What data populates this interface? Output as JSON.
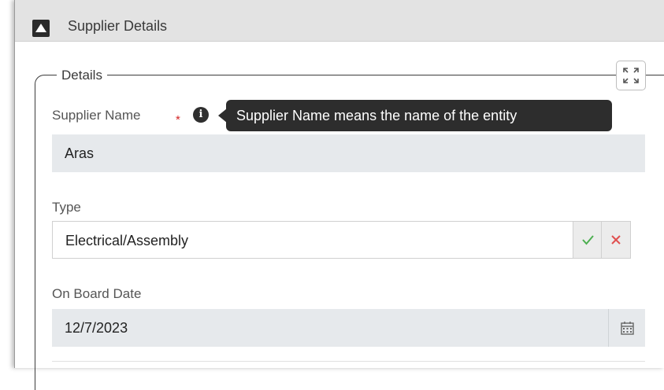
{
  "panel": {
    "title": "Supplier Details",
    "collapse_icon": "triangle-up-icon"
  },
  "details": {
    "legend": "Details",
    "expand_icon": "expand-arrows-icon"
  },
  "fields": {
    "supplier_name": {
      "label": "Supplier Name",
      "required_mark": "*",
      "info_icon": "info-icon",
      "tooltip": "Supplier Name means the name of the entity",
      "value": "Aras"
    },
    "type": {
      "label": "Type",
      "value": "Electrical/Assembly",
      "confirm_icon": "check-icon",
      "cancel_icon": "close-icon"
    },
    "on_board_date": {
      "label": "On Board Date",
      "value": "12/7/2023",
      "calendar_icon": "calendar-icon"
    }
  },
  "colors": {
    "required": "#d32626",
    "confirm": "#4caf50",
    "cancel": "#e05050",
    "tooltip_bg": "#2d2d2d"
  }
}
